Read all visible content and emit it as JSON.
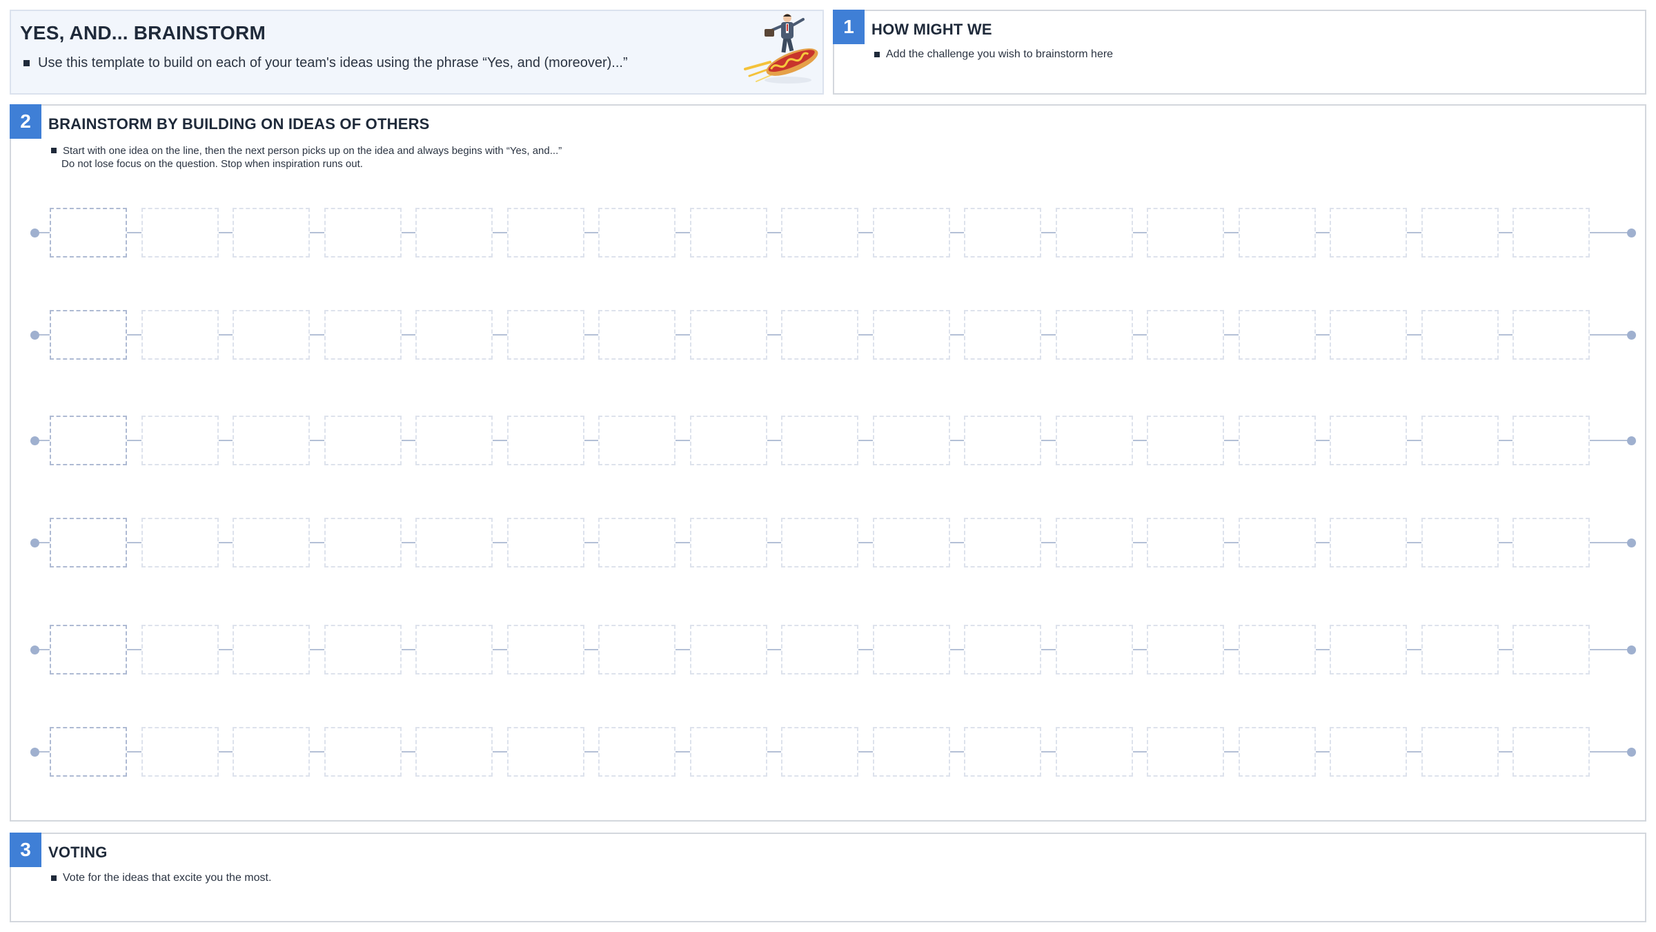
{
  "intro": {
    "title": "YES, AND... BRAINSTORM",
    "description": "Use this template to build on each of your team's ideas using the phrase “Yes, and (moreover)...”",
    "illustration": "businessman-surfing-hotdog-illustration"
  },
  "section1": {
    "number": "1",
    "title": "HOW MIGHT WE",
    "bullet": "Add the challenge you wish to brainstorm here"
  },
  "section2": {
    "number": "2",
    "title": "BRAINSTORM BY BUILDING ON IDEAS OF OTHERS",
    "bullet_line1": "Start with one idea on the line, then the next person picks up on the idea and always begins with “Yes, and...”",
    "bullet_line2": "Do not lose focus on the question. Stop when inspiration runs out.",
    "rows": 6,
    "cells_per_row": 17
  },
  "section3": {
    "number": "3",
    "title": "VOTING",
    "bullet": "Vote for the ideas that excite you the most."
  },
  "colors": {
    "accent": "#3f7fd6",
    "intro_background": "#f2f6fc",
    "panel_border": "#d3d7dd",
    "line": "#b4c0d6",
    "cell_border": "#dde2ec"
  }
}
